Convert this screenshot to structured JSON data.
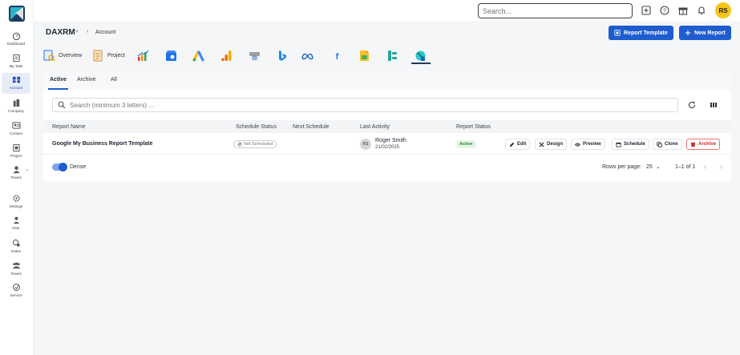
{
  "sidebar": {
    "items": [
      {
        "label": "Dashboard",
        "icon": "dashboard-icon"
      },
      {
        "label": "My Task",
        "icon": "task-icon"
      },
      {
        "label": "Account",
        "icon": "account-icon",
        "active": true
      },
      {
        "label": "Company",
        "icon": "company-icon"
      },
      {
        "label": "Contact",
        "icon": "contact-icon"
      },
      {
        "label": "Project",
        "icon": "project-icon"
      },
      {
        "label": "Teams",
        "icon": "teams-icon"
      },
      {
        "label": "Settings",
        "icon": "settings-icon"
      },
      {
        "label": "User",
        "icon": "user-icon"
      },
      {
        "label": "Roles",
        "icon": "roles-icon"
      },
      {
        "label": "Teams",
        "icon": "teams-group-icon"
      },
      {
        "label": "Service",
        "icon": "service-icon"
      }
    ]
  },
  "header": {
    "search_placeholder": "Search...",
    "avatar_initials": "RS"
  },
  "breadcrumb": {
    "brand": "DAXRM",
    "page": "Account"
  },
  "actions": {
    "report_template": "Report Template",
    "new_report": "New Report"
  },
  "integrations": [
    {
      "label": "Overview",
      "icon": "overview-icon"
    },
    {
      "label": "Project",
      "icon": "project-report-icon"
    },
    {
      "label": "",
      "icon": "analytics-chart-icon"
    },
    {
      "label": "",
      "icon": "google-my-business-icon"
    },
    {
      "label": "",
      "icon": "google-ads-icon"
    },
    {
      "label": "",
      "icon": "google-analytics-icon"
    },
    {
      "label": "",
      "icon": "search-console-icon"
    },
    {
      "label": "",
      "icon": "bing-icon"
    },
    {
      "label": "",
      "icon": "meta-ads-icon"
    },
    {
      "label": "",
      "icon": "facebook-icon"
    },
    {
      "label": "",
      "icon": "google-sheets-icon"
    },
    {
      "label": "",
      "icon": "data-studio-icon"
    },
    {
      "label": "",
      "icon": "globe-report-icon"
    }
  ],
  "tabs": [
    {
      "label": "Active"
    },
    {
      "label": "Archive"
    },
    {
      "label": "All"
    }
  ],
  "table": {
    "search_placeholder": "Search (minimum 3 letters) ...",
    "columns": [
      "Report Name",
      "Schedule Status",
      "Next Schedule",
      "Last Activity",
      "Report Status"
    ],
    "rows": [
      {
        "name": "Google My Business Report Template",
        "schedule_status": "Not Scheduled",
        "next_schedule": "",
        "user_initials": "RS",
        "user_name": "Roger Smith",
        "date": "21/02/2025",
        "report_status": "Active",
        "actions": [
          "Edit",
          "Design",
          "Preview",
          "Schedule",
          "Clone",
          "Archive"
        ]
      }
    ]
  },
  "footer": {
    "dense_label": "Dense",
    "rows_per_page_label": "Rows per page:",
    "rows_per_page_value": "25",
    "range": "1–1 of 1"
  },
  "colors": {
    "primary": "#1e5ccf",
    "active_status": "#1c8a35",
    "danger": "#c62828",
    "avatar": "#f5c518"
  }
}
